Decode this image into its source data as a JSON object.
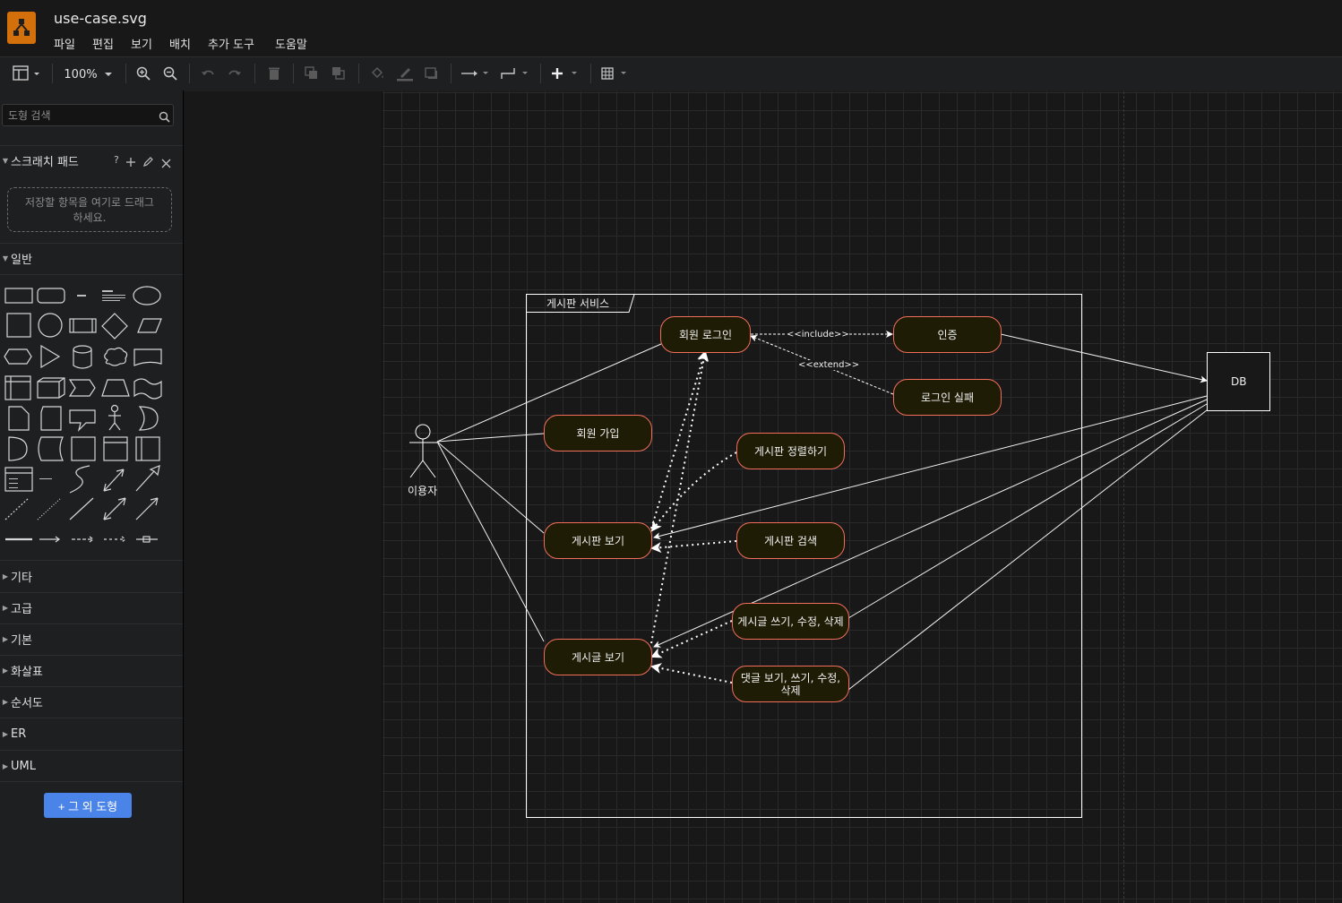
{
  "app": {
    "file_title": "use-case.svg"
  },
  "menu": [
    "파일",
    "편집",
    "보기",
    "배치",
    "추가 도구",
    "도움말"
  ],
  "toolbar": {
    "zoom": "100%"
  },
  "sidebar": {
    "search_placeholder": "도형 검색",
    "scratchpad": {
      "title": "스크래치 패드",
      "help": "?",
      "drop_hint_1": "저장할 항목을 여기로 드래그",
      "drop_hint_2": "하세요."
    },
    "general_title": "일반",
    "sections": [
      "기타",
      "고급",
      "기본",
      "화살표",
      "순서도",
      "ER",
      "UML"
    ],
    "more_shapes": "+ 그 외 도형"
  },
  "diagram": {
    "boundary": "게시판 서비스",
    "actor": "이용자",
    "db": "DB",
    "usecases": {
      "login": "회원 로그인",
      "signup": "회원 가입",
      "auth": "인증",
      "login_fail": "로그인 실패",
      "sort": "게시판 정렬하기",
      "board_view": "게시판 보기",
      "board_search": "게시판 검색",
      "post_write": "게시글 쓰기, 수정, 삭제",
      "post_view": "게시글 보기",
      "comment_1": "댓글 보기, 쓰기, 수정,",
      "comment_2": "삭제"
    },
    "labels": {
      "include": "<<include>>",
      "extend": "<<extend>>"
    }
  }
}
